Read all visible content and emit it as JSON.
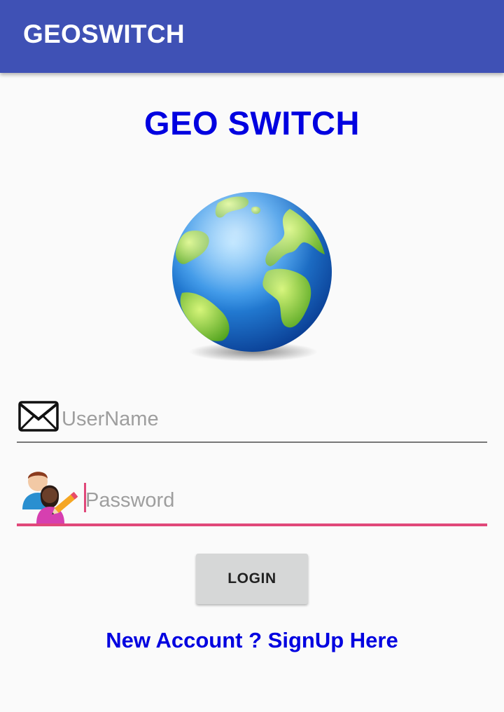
{
  "app_bar": {
    "title": "GEOSWITCH"
  },
  "main": {
    "heading": "GEO SWITCH",
    "logo_icon": "globe-icon",
    "username_field": {
      "placeholder": "UserName",
      "value": "",
      "icon": "mail-icon"
    },
    "password_field": {
      "placeholder": "Password",
      "value": "",
      "icon": "users-edit-icon",
      "focused": true
    },
    "login_button": {
      "label": "LOGIN"
    },
    "signup_link": {
      "label": "New Account ? SignUp Here"
    }
  },
  "colors": {
    "app_bar": "#3f51b5",
    "accent": "#e0487a",
    "link_blue": "#0000e0",
    "background": "#fafafa",
    "button": "#d6d7d7"
  }
}
